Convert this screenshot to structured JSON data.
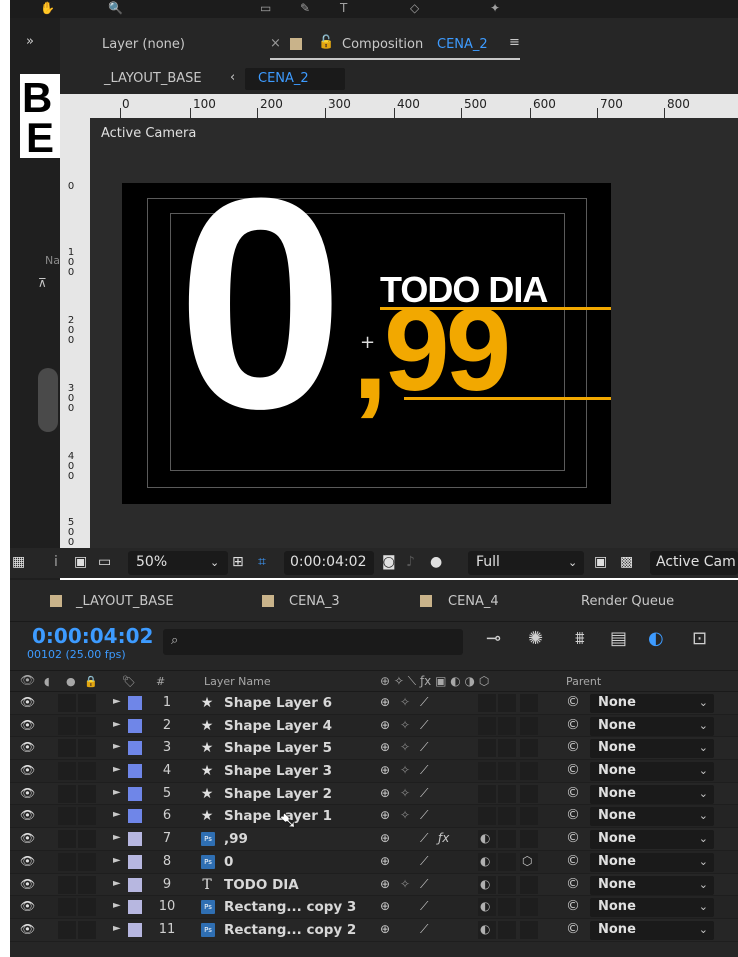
{
  "viewer": {
    "panel_collapse": "»",
    "layer_tab": "Layer (none)",
    "comp_tab_prefix": "Composition",
    "comp_tab_name": "CENA_2",
    "breadcrumb_parent": "_LAYOUT_BASE",
    "breadcrumb_current": "CENA_2",
    "ruler_marks": [
      "0",
      "100",
      "200",
      "300",
      "400",
      "500",
      "600",
      "700",
      "800"
    ],
    "vruler_marks": [
      "0",
      "100",
      "200",
      "300",
      "400",
      "500"
    ],
    "camera_label": "Active Camera",
    "strip_label": "Na"
  },
  "composition_content": {
    "big_digit": "0",
    "comma": ",",
    "headline": "TODO DIA",
    "price_cents": "99",
    "text_white": "#ffffff",
    "accent_gold": "#f2a800"
  },
  "viewer_controls": {
    "zoom": "50%",
    "timecode": "0:00:04:02",
    "resolution": "Full",
    "view": "Active Cam"
  },
  "timeline": {
    "tabs": [
      {
        "label": "_LAYOUT_BASE"
      },
      {
        "label": "CENA_3"
      },
      {
        "label": "CENA_4"
      },
      {
        "label": "Render Queue"
      }
    ],
    "current_time": "0:00:04:02",
    "frame_info": "00102 (25.00 fps)",
    "column_headers": {
      "number": "#",
      "layer_name": "Layer Name",
      "parent": "Parent"
    },
    "layers": [
      {
        "num": "1",
        "type": "shape",
        "name": "Shape Layer 6",
        "label_color": "#6f86e8",
        "fx": false,
        "collapse": true,
        "motion_blur": false,
        "three_d": false,
        "parent": "None"
      },
      {
        "num": "2",
        "type": "shape",
        "name": "Shape Layer 4",
        "label_color": "#6f86e8",
        "fx": false,
        "collapse": true,
        "motion_blur": false,
        "three_d": false,
        "parent": "None"
      },
      {
        "num": "3",
        "type": "shape",
        "name": "Shape Layer 5",
        "label_color": "#6f86e8",
        "fx": false,
        "collapse": true,
        "motion_blur": false,
        "three_d": false,
        "parent": "None"
      },
      {
        "num": "4",
        "type": "shape",
        "name": "Shape Layer 3",
        "label_color": "#6f86e8",
        "fx": false,
        "collapse": true,
        "motion_blur": false,
        "three_d": false,
        "parent": "None"
      },
      {
        "num": "5",
        "type": "shape",
        "name": "Shape Layer 2",
        "label_color": "#6f86e8",
        "fx": false,
        "collapse": true,
        "motion_blur": false,
        "three_d": false,
        "parent": "None"
      },
      {
        "num": "6",
        "type": "shape",
        "name": "Shape Layer 1",
        "label_color": "#6f86e8",
        "fx": false,
        "collapse": true,
        "motion_blur": false,
        "three_d": false,
        "parent": "None"
      },
      {
        "num": "7",
        "type": "footage",
        "name": ",99",
        "label_color": "#b7b7e0",
        "fx": true,
        "collapse": false,
        "motion_blur": true,
        "three_d": false,
        "parent": "None"
      },
      {
        "num": "8",
        "type": "footage",
        "name": "0",
        "label_color": "#b7b7e0",
        "fx": false,
        "collapse": false,
        "motion_blur": true,
        "three_d": true,
        "parent": "None"
      },
      {
        "num": "9",
        "type": "text",
        "name": "TODO DIA",
        "label_color": "#b7b7e0",
        "fx": false,
        "collapse": true,
        "motion_blur": true,
        "three_d": false,
        "parent": "None"
      },
      {
        "num": "10",
        "type": "footage",
        "name": "Rectang... copy 3",
        "label_color": "#b7b7e0",
        "fx": false,
        "collapse": false,
        "motion_blur": true,
        "three_d": false,
        "parent": "None"
      },
      {
        "num": "11",
        "type": "footage",
        "name": "Rectang... copy 2",
        "label_color": "#b7b7e0",
        "fx": false,
        "collapse": false,
        "motion_blur": true,
        "three_d": false,
        "parent": "None"
      }
    ]
  },
  "colors": {
    "accent_blue": "#3d9bff",
    "panel_bg": "#262626",
    "tab_swatch": "#c9b38a"
  }
}
